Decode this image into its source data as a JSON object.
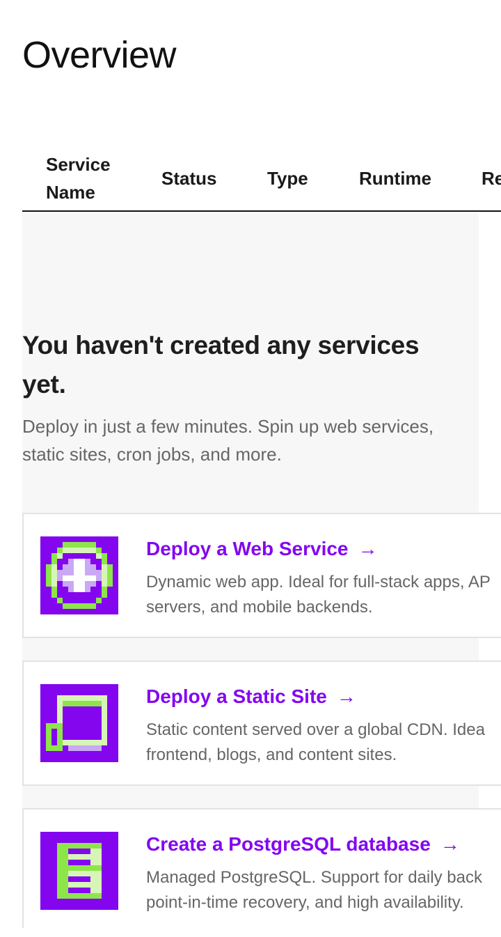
{
  "page": {
    "title": "Overview"
  },
  "table": {
    "columns": [
      "Service Name",
      "Status",
      "Type",
      "Runtime",
      "Re"
    ]
  },
  "empty_state": {
    "heading": "You haven't created any services yet.",
    "heading_line1": "You haven't created any services",
    "heading_line2": "yet.",
    "subtext_line1": "Deploy in just a few minutes. Spin up web services,",
    "subtext_line2": "static sites, cron jobs, and more."
  },
  "cards": [
    {
      "title": "Deploy a Web Service",
      "arrow": "→",
      "icon": "globe-icon",
      "desc_line1": "Dynamic web app. Ideal for full-stack apps, AP",
      "desc_line2": "servers, and mobile backends."
    },
    {
      "title": "Deploy a Static Site",
      "arrow": "→",
      "icon": "browser-window-icon",
      "desc_line1": "Static content served over a global CDN. Idea",
      "desc_line2": "frontend, blogs, and content sites."
    },
    {
      "title": "Create a PostgreSQL database",
      "arrow": "→",
      "icon": "database-icon",
      "desc_line1": "Managed PostgreSQL. Support for daily back",
      "desc_line2": "point-in-time recovery, and high availability."
    }
  ],
  "colors": {
    "accent": "#8306ef",
    "icon_green": "#8ee54a",
    "icon_light": "#d8f5b8",
    "icon_lavender": "#c9a8f5"
  }
}
